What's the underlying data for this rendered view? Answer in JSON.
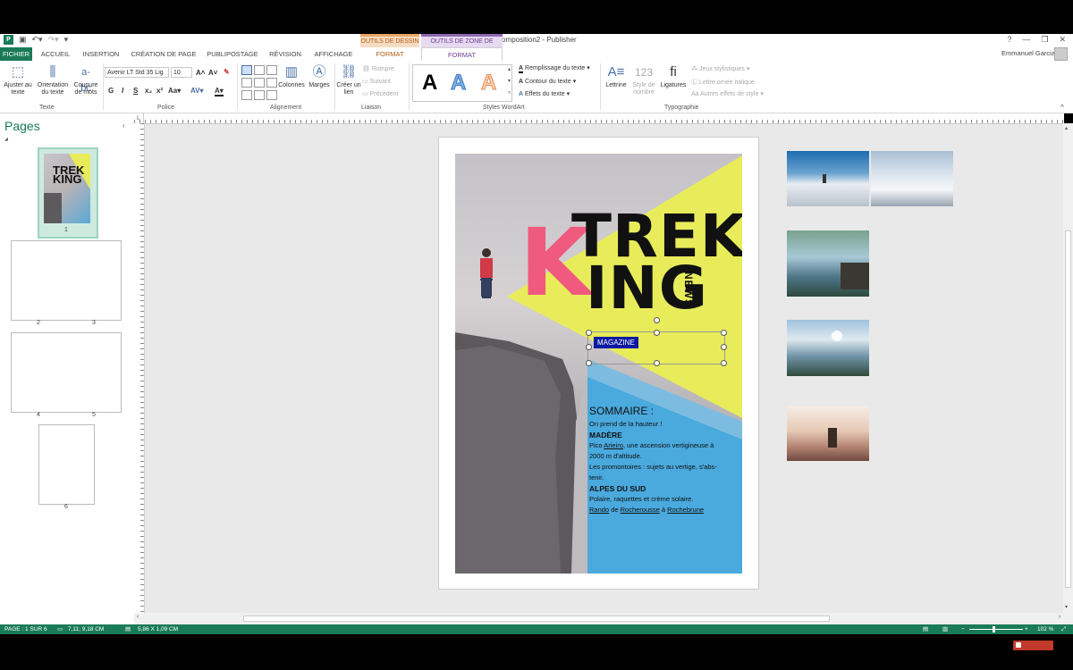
{
  "app": {
    "document_title": "Composition2 - Publisher",
    "user_name": "Emmanuel Garcia"
  },
  "context_tabs": {
    "drawing_tools": "OUTILS DE DESSIN",
    "textbox_tools": "OUTILS DE ZONE DE TEXTE"
  },
  "tabs": [
    "FICHIER",
    "ACCUEIL",
    "INSERTION",
    "CRÉATION DE PAGE",
    "PUBLIPOSTAGE",
    "RÉVISION",
    "AFFICHAGE",
    "FORMAT",
    "FORMAT"
  ],
  "ribbon": {
    "texte": {
      "group_label": "Texte",
      "fit_text": "Ajuster au texte",
      "text_direction": "Orientation du texte",
      "hyphenation": "Coupure de mots"
    },
    "police": {
      "group_label": "Police",
      "font_name": "Avenir LT Std 35 Lig",
      "font_size": "10"
    },
    "alignement": {
      "group_label": "Alignement",
      "columns": "Colonnes",
      "margins": "Marges"
    },
    "liaison": {
      "group_label": "Liaison",
      "create_link": "Créer un lien",
      "break": "Rompre",
      "next": "Suivant",
      "previous": "Précédent"
    },
    "wordart": {
      "group_label": "Styles WordArt",
      "fill": "Remplissage du texte",
      "outline": "Contour du texte",
      "effects": "Effets du texte"
    },
    "typographie": {
      "group_label": "Typographie",
      "drop_cap": "Lettrine",
      "number_style": "Style de nombre",
      "ligatures": "Ligatures",
      "stylistic_sets": "Jeux stylistiques",
      "swash": "Lettre ornée italique",
      "other_effects": "Autres effets de style"
    }
  },
  "pages_pane": {
    "title": "Pages",
    "thumbs": [
      "1",
      "2",
      "3",
      "4",
      "5",
      "6"
    ],
    "thumb_title": "TREK KING"
  },
  "cover": {
    "letter_k": "K",
    "trek": "TREK",
    "ing": "ING",
    "news": "NEWS",
    "magazine": "MAGAZINE",
    "toc_title": "SOMMAIRE :",
    "toc_line1": "On prend de la hauteur !",
    "section1": "MADÈRE",
    "s1_line1a": "Pico ",
    "s1_link": "Arieiro",
    "s1_line1b": ", une ascension vertigineuse à",
    "s1_line2": "2000 m d'altitude.",
    "s1_line3": "Les promontoires : sujets au vertige, s'abs-",
    "s1_line4": "tenir.",
    "section2": "ALPES DU SUD",
    "s2_line1": "Polaire, raquettes et crème solaire.",
    "s2_rando": "Rando",
    "s2_de": " de ",
    "s2_link1": "Rocherousse",
    "s2_a": " à ",
    "s2_link2": "Rochebrune"
  },
  "status": {
    "page": "PAGE : 1 SUR 6",
    "position": "7,11; 9,18 CM",
    "size": "5,86 X 1,09 CM",
    "zoom": "102 %"
  },
  "colors": {
    "publisher_green": "#1a7b57",
    "pink": "#f05a7e",
    "yellow": "#e8ec5a",
    "blue": "#49a8dc"
  }
}
